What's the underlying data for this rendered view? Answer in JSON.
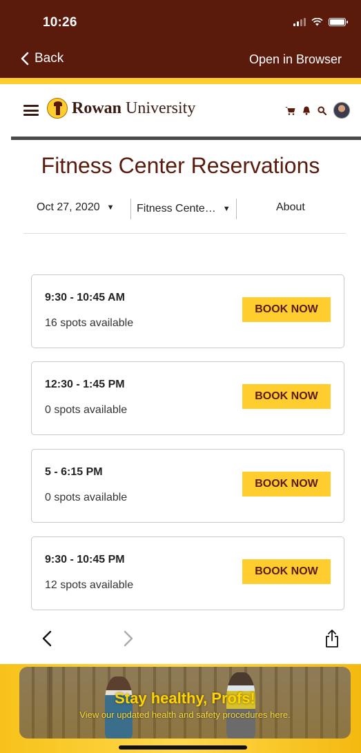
{
  "status_bar": {
    "time": "10:26"
  },
  "top_bar": {
    "back_label": "Back",
    "open_in_browser_label": "Open in Browser"
  },
  "site": {
    "logo_name": "Rowan",
    "logo_suffix": " University"
  },
  "page": {
    "title": "Fitness Center Reservations"
  },
  "filters": {
    "date": "Oct 27, 2020",
    "location": "Fitness Cente…",
    "about": "About"
  },
  "slots": [
    {
      "time": "9:30 - 10:45 AM",
      "spots": "16 spots available",
      "button": "BOOK NOW"
    },
    {
      "time": "12:30 - 1:45 PM",
      "spots": "0 spots available",
      "button": "BOOK NOW"
    },
    {
      "time": "5 - 6:15 PM",
      "spots": "0 spots available",
      "button": "BOOK NOW"
    },
    {
      "time": "9:30 - 10:45 PM",
      "spots": "12 spots available",
      "button": "BOOK NOW"
    }
  ],
  "banner": {
    "headline": "Stay healthy, Profs!",
    "subtext": "View our updated health and safety procedures here."
  },
  "colors": {
    "brand_maroon": "#5a1a0c",
    "brand_gold": "#ffcd2e"
  },
  "icons": {
    "cart": "cart-icon",
    "bell": "bell-icon",
    "search": "search-icon",
    "share": "share-icon"
  }
}
